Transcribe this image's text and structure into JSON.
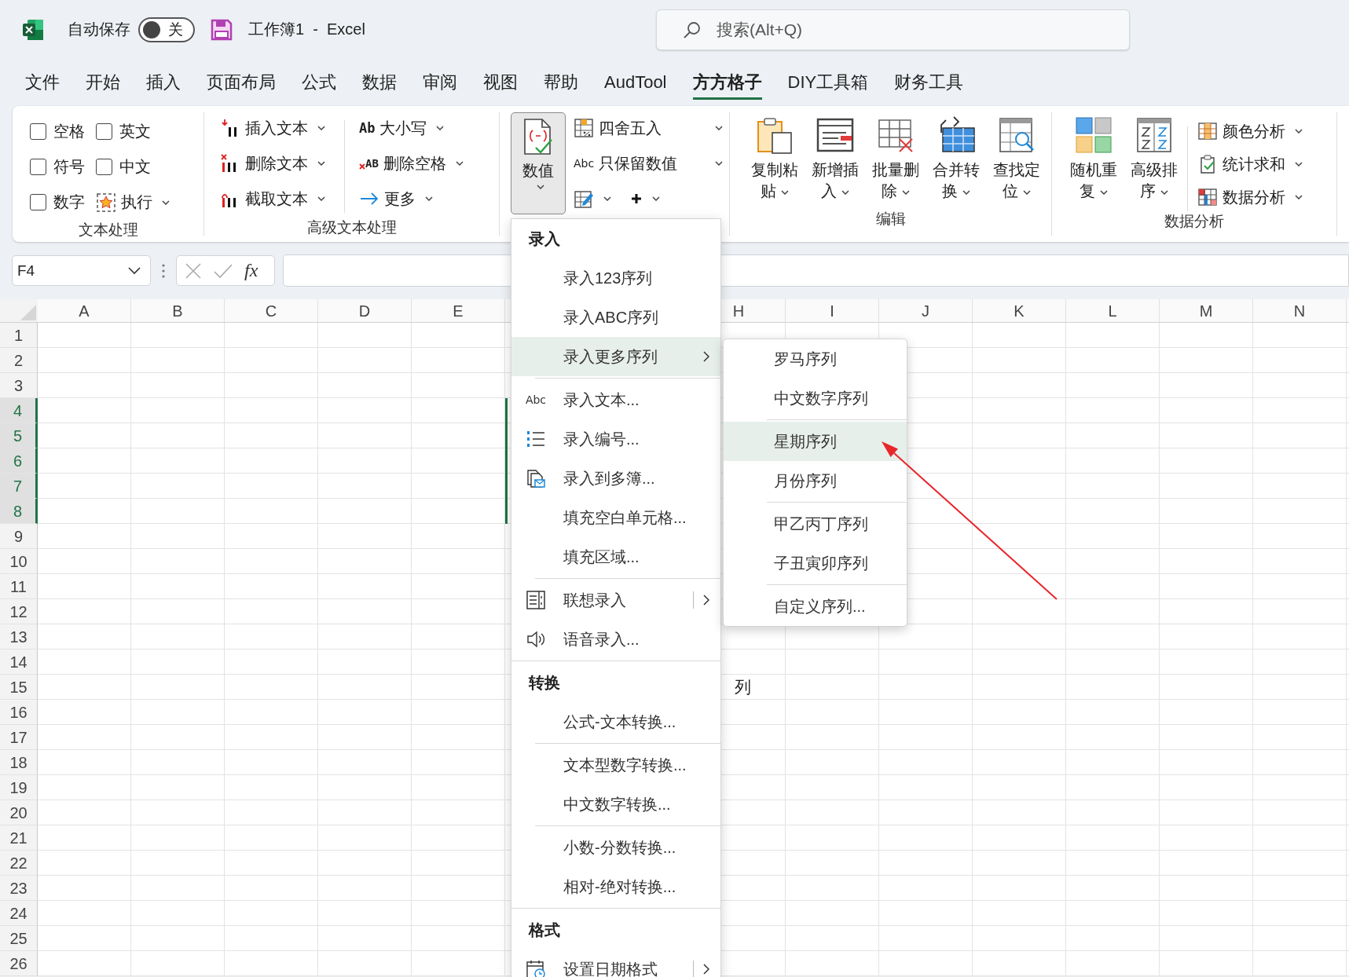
{
  "title_bar": {
    "autosave_label": "自动保存",
    "autosave_toggle": {
      "on": false,
      "label": "关"
    },
    "title": "工作簿1  -  Excel",
    "search": {
      "placeholder": "搜索(Alt+Q)"
    }
  },
  "menu_tabs": [
    {
      "label": "文件",
      "selected": false
    },
    {
      "label": "开始",
      "selected": false
    },
    {
      "label": "插入",
      "selected": false
    },
    {
      "label": "页面布局",
      "selected": false
    },
    {
      "label": "公式",
      "selected": false
    },
    {
      "label": "数据",
      "selected": false
    },
    {
      "label": "审阅",
      "selected": false
    },
    {
      "label": "视图",
      "selected": false
    },
    {
      "label": "帮助",
      "selected": false
    },
    {
      "label": "AudTool",
      "selected": false
    },
    {
      "label": "方方格子",
      "selected": true
    },
    {
      "label": "DIY工具箱",
      "selected": false
    },
    {
      "label": "财务工具",
      "selected": false
    }
  ],
  "ribbon": {
    "text_group": {
      "label": "文本处理",
      "checkboxes": [
        {
          "label": "空格",
          "checked": false
        },
        {
          "label": "英文",
          "checked": false
        },
        {
          "label": "符号",
          "checked": false
        },
        {
          "label": "中文",
          "checked": false
        },
        {
          "label": "数字",
          "checked": false
        }
      ],
      "run_button": "执行"
    },
    "advanced_text_group": {
      "label": "高级文本处理",
      "buttons": [
        {
          "label": "插入文本"
        },
        {
          "label": "删除文本"
        },
        {
          "label": "截取文本"
        },
        {
          "label": "大小写",
          "icon_text": "Ab"
        },
        {
          "label": "删除空格",
          "icon_text": "AB"
        },
        {
          "label": "更多"
        }
      ]
    },
    "numeric_group": {
      "main_button": {
        "label": "数值",
        "pressed": true
      },
      "buttons": [
        {
          "label": "四舍五入"
        },
        {
          "label": "只保留数值",
          "icon_text": "Abc"
        }
      ]
    },
    "edit_group": {
      "label": "编辑",
      "buttons": [
        "复制粘贴",
        "新增插入",
        "批量删除",
        "合并转换",
        "查找定位"
      ]
    },
    "analysis_group": {
      "label": "数据分析",
      "large_buttons": [
        "随机重复",
        "高级排序"
      ],
      "buttons": [
        "颜色分析",
        "统计求和",
        "数据分析"
      ]
    }
  },
  "formula_bar": {
    "name_box": "F4",
    "function_label": "fx"
  },
  "sheet": {
    "columns": [
      "A",
      "B",
      "C",
      "D",
      "E",
      "H",
      "I",
      "J",
      "K",
      "L",
      "M",
      "N"
    ],
    "rows": [
      {
        "label": "1",
        "selected": false
      },
      {
        "label": "2",
        "selected": false
      },
      {
        "label": "3",
        "selected": false
      },
      {
        "label": "4",
        "selected": true
      },
      {
        "label": "5",
        "selected": true
      },
      {
        "label": "6",
        "selected": true
      },
      {
        "label": "7",
        "selected": true
      },
      {
        "label": "8",
        "selected": true
      },
      {
        "label": "9",
        "selected": false
      },
      {
        "label": "10",
        "selected": false
      },
      {
        "label": "11",
        "selected": false
      },
      {
        "label": "12",
        "selected": false
      },
      {
        "label": "13",
        "selected": false
      },
      {
        "label": "14",
        "selected": false
      },
      {
        "label": "15",
        "selected": false,
        "text": "列"
      },
      {
        "label": "16",
        "selected": false
      },
      {
        "label": "17",
        "selected": false
      },
      {
        "label": "18",
        "selected": false
      },
      {
        "label": "19",
        "selected": false
      },
      {
        "label": "20",
        "selected": false
      },
      {
        "label": "21",
        "selected": false
      },
      {
        "label": "22",
        "selected": false
      },
      {
        "label": "23",
        "selected": false
      },
      {
        "label": "24",
        "selected": false
      },
      {
        "label": "25",
        "selected": false
      },
      {
        "label": "26",
        "selected": false
      }
    ]
  },
  "context_menu": {
    "items": [
      {
        "kind": "header",
        "label": "录入"
      },
      {
        "kind": "item",
        "label": "录入123序列",
        "selected": false
      },
      {
        "kind": "item",
        "label": "录入ABC序列",
        "selected": false
      },
      {
        "kind": "submenu",
        "label": "录入更多序列",
        "selected": true
      },
      {
        "kind": "separator",
        "full": false
      },
      {
        "kind": "item",
        "label": "录入文本...",
        "icon_text": "Abc",
        "selected": false
      },
      {
        "kind": "item",
        "label": "录入编号...",
        "selected": false
      },
      {
        "kind": "item",
        "label": "录入到多簿...",
        "selected": false
      },
      {
        "kind": "item",
        "label": "填充空白单元格...",
        "selected": false
      },
      {
        "kind": "item",
        "label": "填充区域...",
        "selected": false
      },
      {
        "kind": "separator",
        "full": false
      },
      {
        "kind": "split",
        "label": "联想录入",
        "selected": false
      },
      {
        "kind": "item",
        "label": "语音录入...",
        "selected": false
      },
      {
        "kind": "separator",
        "full": true
      },
      {
        "kind": "header",
        "label": "转换"
      },
      {
        "kind": "item",
        "label": "公式-文本转换...",
        "selected": false
      },
      {
        "kind": "separator",
        "full": false
      },
      {
        "kind": "item",
        "label": "文本型数字转换...",
        "selected": false
      },
      {
        "kind": "item",
        "label": "中文数字转换...",
        "selected": false
      },
      {
        "kind": "separator",
        "full": false
      },
      {
        "kind": "item",
        "label": "小数-分数转换...",
        "selected": false
      },
      {
        "kind": "item",
        "label": "相对-绝对转换...",
        "selected": false
      },
      {
        "kind": "separator",
        "full": true
      },
      {
        "kind": "header",
        "label": "格式"
      },
      {
        "kind": "split",
        "label": "设置日期格式",
        "selected": false
      }
    ]
  },
  "submenu": {
    "items": [
      {
        "kind": "item",
        "label": "罗马序列",
        "selected": false
      },
      {
        "kind": "item",
        "label": "中文数字序列",
        "selected": false
      },
      {
        "kind": "separator"
      },
      {
        "kind": "item",
        "label": "星期序列",
        "selected": true
      },
      {
        "kind": "item",
        "label": "月份序列",
        "selected": false
      },
      {
        "kind": "separator"
      },
      {
        "kind": "item",
        "label": "甲乙丙丁序列",
        "selected": false
      },
      {
        "kind": "item",
        "label": "子丑寅卯序列",
        "selected": false
      },
      {
        "kind": "separator"
      },
      {
        "kind": "item",
        "label": "自定义序列...",
        "selected": false
      }
    ]
  }
}
